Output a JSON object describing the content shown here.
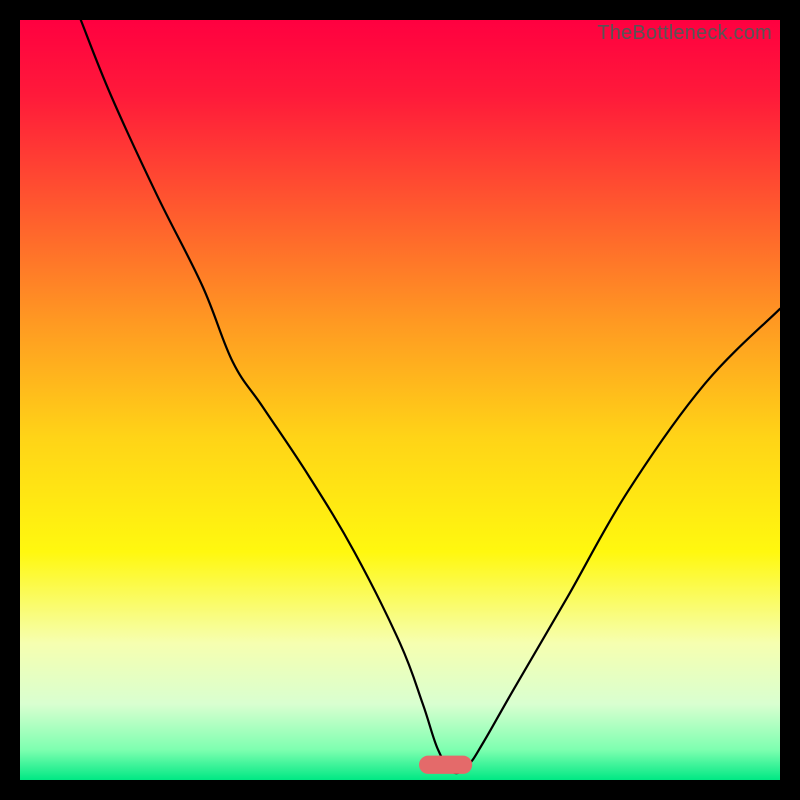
{
  "watermark": "TheBottleneck.com",
  "chart_data": {
    "type": "line",
    "title": "",
    "xlabel": "",
    "ylabel": "",
    "xlim": [
      0,
      100
    ],
    "ylim": [
      0,
      100
    ],
    "grid": false,
    "legend": false,
    "background": {
      "type": "vertical-gradient",
      "stops": [
        {
          "pos": 0.0,
          "color": "#ff0040"
        },
        {
          "pos": 0.1,
          "color": "#ff1a3a"
        },
        {
          "pos": 0.25,
          "color": "#ff5a2e"
        },
        {
          "pos": 0.4,
          "color": "#ff9a22"
        },
        {
          "pos": 0.55,
          "color": "#ffd417"
        },
        {
          "pos": 0.7,
          "color": "#fff80f"
        },
        {
          "pos": 0.82,
          "color": "#f6ffb0"
        },
        {
          "pos": 0.9,
          "color": "#d9ffd0"
        },
        {
          "pos": 0.96,
          "color": "#7effb0"
        },
        {
          "pos": 1.0,
          "color": "#00e884"
        }
      ]
    },
    "marker": {
      "shape": "rounded-rect",
      "x": 56,
      "y": 2,
      "width": 7,
      "height": 2.4,
      "color": "#e46a6a",
      "corner_radius": 1.2
    },
    "series": [
      {
        "name": "bottleneck-curve",
        "color": "#000000",
        "stroke_width": 2.2,
        "x": [
          8,
          12,
          18,
          24,
          28,
          32,
          38,
          44,
          50,
          53,
          55,
          57,
          59,
          61,
          65,
          72,
          80,
          90,
          100
        ],
        "y": [
          100,
          90,
          77,
          65,
          55,
          49,
          40,
          30,
          18,
          10,
          4,
          1,
          2,
          5,
          12,
          24,
          38,
          52,
          62
        ]
      }
    ]
  }
}
